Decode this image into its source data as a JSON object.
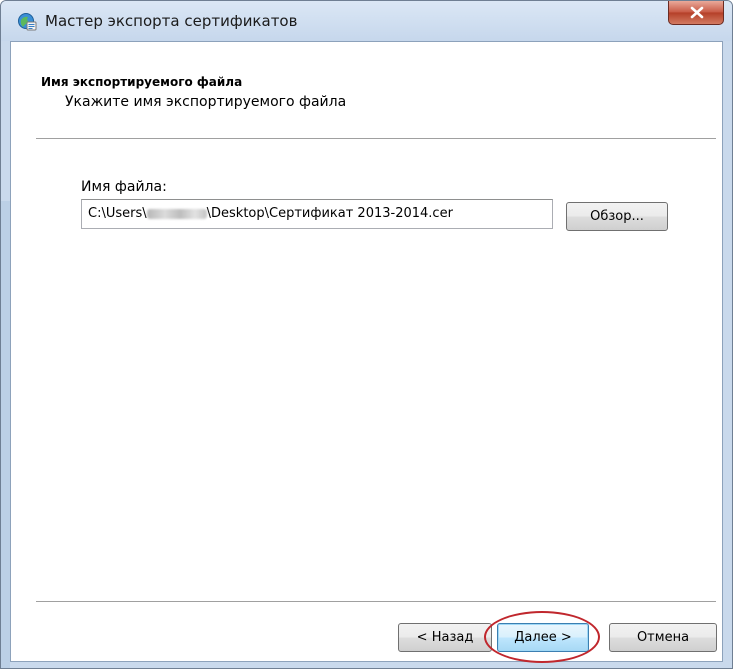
{
  "window": {
    "title": "Мастер экспорта сертификатов",
    "icon": "certificate-wizard-icon",
    "close_icon": "close-icon"
  },
  "header": {
    "heading": "Имя экспортируемого файла",
    "subheading": "Укажите имя экспортируемого файла"
  },
  "form": {
    "file_label": "Имя файла:",
    "file_value_prefix": "C:\\Users\\",
    "file_value_suffix": "\\Desktop\\Сертификат 2013-2014.cer",
    "browse_label": "Обзор..."
  },
  "footer": {
    "back_label": "< Назад",
    "next_label": "Далее >",
    "cancel_label": "Отмена"
  },
  "colors": {
    "annotation": "#c0272d",
    "close_button": "#c75843",
    "default_button_border": "#3c7fb1"
  }
}
